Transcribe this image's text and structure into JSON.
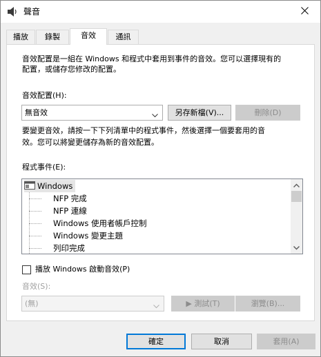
{
  "window": {
    "title": "聲音",
    "close_icon": "close-icon",
    "speaker_icon": "speaker-icon"
  },
  "tabs": [
    {
      "label": "播放",
      "active": false
    },
    {
      "label": "錄製",
      "active": false
    },
    {
      "label": "音效",
      "active": true
    },
    {
      "label": "通訊",
      "active": false
    }
  ],
  "description": {
    "line1": "音效配置是一組在 Windows 和程式中套用到事件的音效。您可以選擇現有的",
    "line2": "配置，或儲存您修改的配置。"
  },
  "scheme": {
    "label": "音效配置(H):",
    "value": "無音效",
    "save_as_label": "另存新檔(V)...",
    "delete_label": "刪除(D)"
  },
  "instructions": {
    "line1": "要變更音效，請按一下下列清單中的程式事件，然後選擇一個要套用的音",
    "line2": "效。您可以將變更儲存為新的音效配置。"
  },
  "events": {
    "label": "程式事件(E):",
    "root": "Windows",
    "items": [
      "NFP 完成",
      "NFP 連線",
      "Windows 使用者帳戶控制",
      "Windows 變更主題",
      "列印完成"
    ]
  },
  "startup_sound": {
    "label": "播放 Windows 啟動音效(P)",
    "checked": false
  },
  "sounds": {
    "label": "音效(S):",
    "value": "(無)",
    "test_label": "▶ 測試(T)",
    "browse_label": "瀏覽(B)..."
  },
  "footer": {
    "ok_label": "確定",
    "cancel_label": "取消",
    "apply_label": "套用(A)"
  },
  "colors": {
    "accent": "#0078d7",
    "selection": "#e5e5e5"
  }
}
